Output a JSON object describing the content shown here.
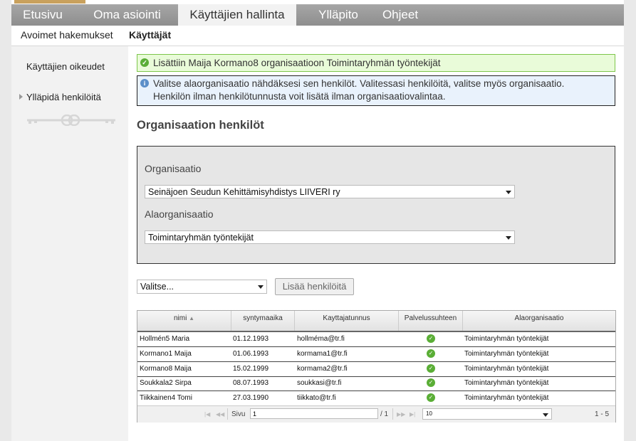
{
  "top_nav": {
    "items": [
      {
        "label": "Etusivu"
      },
      {
        "label": "Oma asiointi"
      },
      {
        "label": "Käyttäjien hallinta"
      },
      {
        "label": "Ylläpito"
      },
      {
        "label": "Ohjeet"
      }
    ],
    "active_index": 2
  },
  "sub_nav": {
    "items": [
      {
        "label": "Avoimet hakemukset"
      },
      {
        "label": "Käyttäjät"
      }
    ],
    "active_index": 1
  },
  "sidebar": {
    "items": [
      {
        "label": "Käyttäjien oikeudet"
      },
      {
        "label": "Ylläpidä henkilöitä"
      }
    ]
  },
  "messages": {
    "success": "Lisättiin Maija Kormano8 organisaatioon Toimintaryhmän työntekijät",
    "info_line1": "Valitse alaorganisaatio nähdäksesi sen henkilöt. Valitessasi henkilöitä, valitse myös organisaatio.",
    "info_line2": "Henkilön ilman henkilötunnusta voit lisätä ilman organisaatiovalintaa."
  },
  "section_title": "Organisaation henkilöt",
  "org_form": {
    "org_label": "Organisaatio",
    "org_value": "Seinäjoen Seudun Kehittämisyhdistys LIIVERI ry",
    "suborg_label": "Alaorganisaatio",
    "suborg_value": "Toimintaryhmän työntekijät"
  },
  "actions": {
    "select_value": "Valitse...",
    "add_button": "Lisää henkilöitä"
  },
  "grid": {
    "columns": [
      "nimi",
      "syntymaaika",
      "Kayttajatunnus",
      "Palvelussuhteen",
      "Alaorganisaatio"
    ],
    "sort_column": "nimi",
    "rows": [
      {
        "name": "Hollmén5 Maria",
        "dob": "01.12.1993",
        "user": "hollméma@tr.fi",
        "suborg": "Toimintaryhmän työntekijät"
      },
      {
        "name": "Kormano1 Maija",
        "dob": "01.06.1993",
        "user": "kormama1@tr.fi",
        "suborg": "Toimintaryhmän työntekijät"
      },
      {
        "name": "Kormano8 Maija",
        "dob": "15.02.1999",
        "user": "kormama2@tr.fi",
        "suborg": "Toimintaryhmän työntekijät"
      },
      {
        "name": "Soukkala2 Sirpa",
        "dob": "08.07.1993",
        "user": "soukkasi@tr.fi",
        "suborg": "Toimintaryhmän työntekijät"
      },
      {
        "name": "Tiikkainen4 Tomi",
        "dob": "27.03.1990",
        "user": "tiikkato@tr.fi",
        "suborg": "Toimintaryhmän työntekijät"
      }
    ],
    "pager": {
      "page_label": "Sivu",
      "page_value": "1",
      "of_pages": "/ 1",
      "page_size": "10",
      "range": "1 - 5"
    }
  },
  "colors": {
    "nav_bg": "#999999",
    "active_tab_bg": "#f2f2f2",
    "success_bg": "#e9fbd9",
    "info_bg": "#e9f2fc",
    "check_green": "#5aae36"
  }
}
